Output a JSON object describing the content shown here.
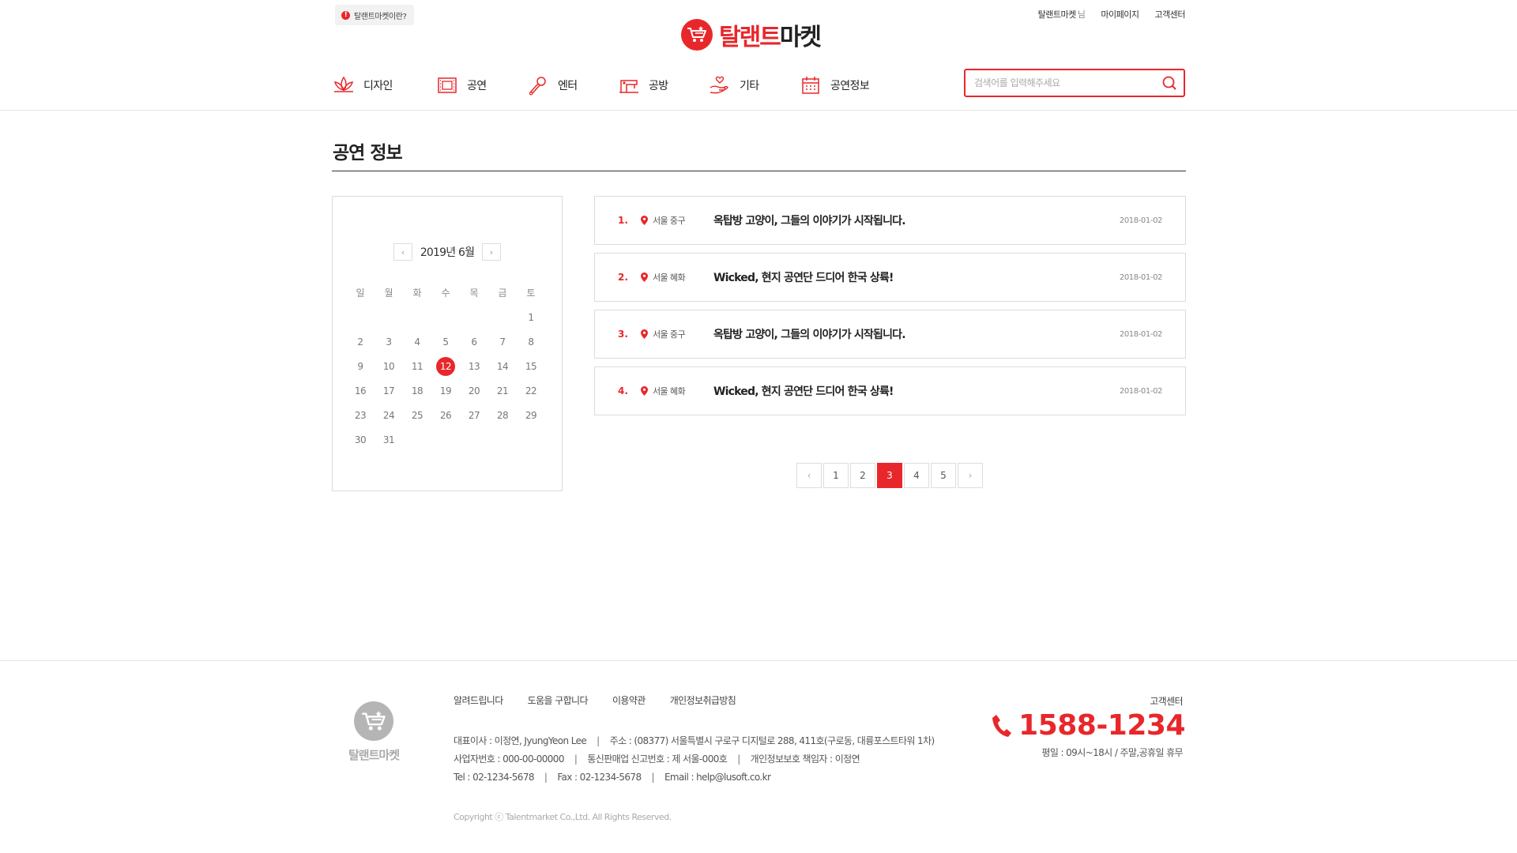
{
  "header": {
    "about_label": "탈랜트마켓이란?",
    "logo_red": "탈랜트",
    "logo_dark": "마켓",
    "user_name": "탈랜트마켓",
    "user_suffix": "님",
    "mypage": "마이페이지",
    "customer_center": "고객센터"
  },
  "nav": {
    "items": [
      {
        "label": "디자인",
        "icon": "lotus-icon"
      },
      {
        "label": "공연",
        "icon": "film-icon"
      },
      {
        "label": "엔터",
        "icon": "microphone-icon"
      },
      {
        "label": "공방",
        "icon": "sewing-machine-icon"
      },
      {
        "label": "기타",
        "icon": "hand-heart-icon"
      },
      {
        "label": "공연정보",
        "icon": "calendar-icon"
      }
    ],
    "search_placeholder": "검색어를 입력해주세요"
  },
  "page": {
    "title": "공연 정보"
  },
  "calendar": {
    "month": "2019년 6월",
    "weekdays": [
      "일",
      "월",
      "화",
      "수",
      "목",
      "금",
      "토"
    ],
    "first_weekday": 6,
    "days_in_month": 31,
    "selected_day": 12
  },
  "events": [
    {
      "num": "1.",
      "location": "서울 중구",
      "title": "옥탑방 고양이, 그들의 이야기가 시작됩니다.",
      "date": "2018-01-02"
    },
    {
      "num": "2.",
      "location": "서울 혜화",
      "title": "Wicked, 현지 공연단 드디어 한국 상륙!",
      "date": "2018-01-02"
    },
    {
      "num": "3.",
      "location": "서울 중구",
      "title": "옥탑방 고양이, 그들의 이야기가 시작됩니다.",
      "date": "2018-01-02"
    },
    {
      "num": "4.",
      "location": "서울 혜화",
      "title": "Wicked, 현지 공연단 드디어 한국 상륙!",
      "date": "2018-01-02"
    }
  ],
  "pagination": {
    "pages": [
      "1",
      "2",
      "3",
      "4",
      "5"
    ],
    "current": "3"
  },
  "footer": {
    "logo_red": "탈랜트",
    "logo_dark": "마켓",
    "links": [
      "알려드립니다",
      "도움을 구합니다",
      "이용약관",
      "개인정보취급방침"
    ],
    "info_line1": [
      "대표이사 : 이정연, JyungYeon Lee",
      "주소 : (08377) 서울특별시 구로구 디지털로 288, 411호(구로동, 대륭포스트타워 1차)"
    ],
    "info_line2": [
      "사업자번호 : 000-00-00000",
      "통신판매업 신고번호 : 제 서울-000호",
      "개인정보보호 책임자 : 이정연"
    ],
    "info_line3": [
      "Tel : 02-1234-5678",
      "Fax : 02-1234-5678",
      "Email : help@lusoft.co.kr"
    ],
    "copyright": "Copyright ⓒ Talentmarket Co.,Ltd. All Rights Reserved.",
    "cs_label": "고객센터",
    "cs_phone": "1588-1234",
    "cs_hours": "평일 : 09시~18시 / 주말,공휴일 휴무"
  },
  "colors": {
    "accent": "#e8272b"
  }
}
